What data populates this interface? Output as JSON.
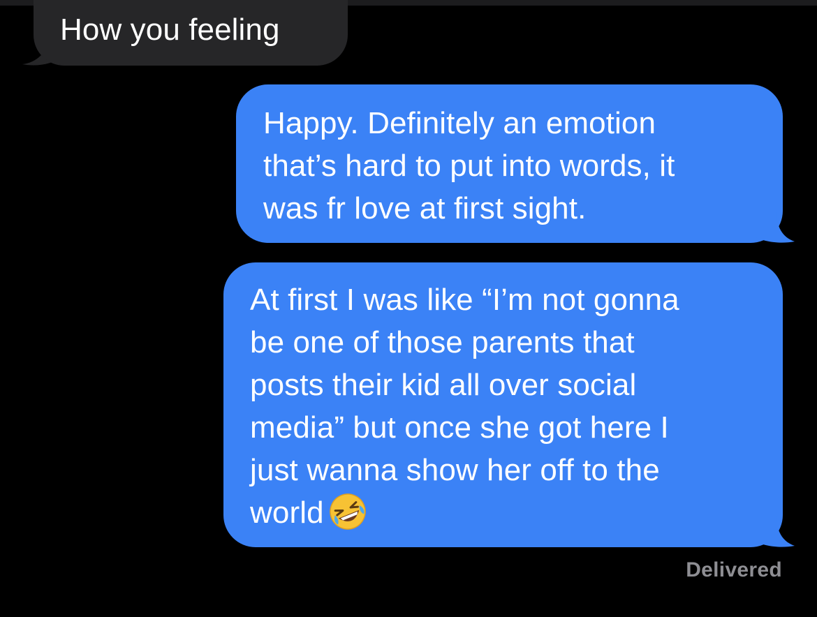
{
  "conversation": {
    "messages": [
      {
        "direction": "received",
        "lines": [
          "How you feeling"
        ],
        "bubble_color": "#262628"
      },
      {
        "direction": "sent",
        "lines": [
          "Happy. Definitely an emotion",
          "that’s hard to put into words, it",
          "was fr love at first sight."
        ],
        "bubble_color": "#3b82f6"
      },
      {
        "direction": "sent",
        "lines": [
          "At first I was like “I’m not gonna",
          "be one of those parents that",
          "posts their kid all over social",
          "media” but once she got here I",
          "just wanna show her off to the",
          "world"
        ],
        "emoji": "rolling-on-the-floor-laughing",
        "bubble_color": "#3b82f6"
      }
    ],
    "status": "Delivered"
  },
  "colors": {
    "background": "#000000",
    "sent_bubble": "#3b82f6",
    "received_bubble": "#262628",
    "status_text": "#8e8e93"
  }
}
